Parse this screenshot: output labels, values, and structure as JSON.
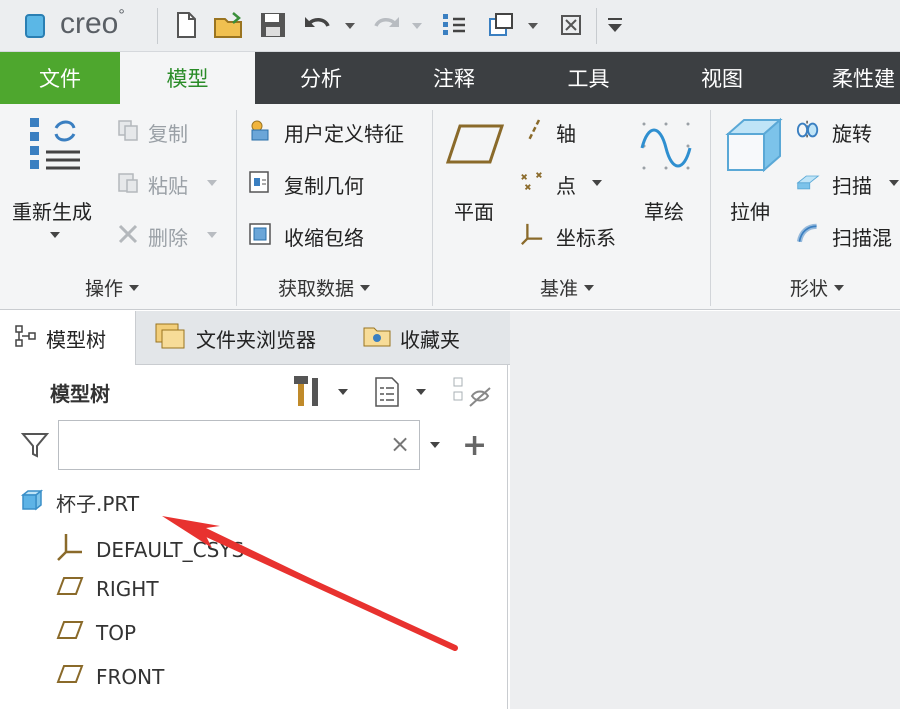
{
  "app": {
    "name": "creo",
    "trademark": "°"
  },
  "tabs": [
    {
      "label": "文件"
    },
    {
      "label": "模型"
    },
    {
      "label": "分析"
    },
    {
      "label": "注释"
    },
    {
      "label": "工具"
    },
    {
      "label": "视图"
    },
    {
      "label": "柔性建"
    }
  ],
  "ribbon": {
    "operations": {
      "regenerate": "重新生成",
      "copy": "复制",
      "paste": "粘贴",
      "delete": "删除",
      "group_label": "操作"
    },
    "get_data": {
      "user_defined_feature": "用户定义特征",
      "copy_geometry": "复制几何",
      "shrinkwrap": "收缩包络",
      "group_label": "获取数据"
    },
    "datum": {
      "plane": "平面",
      "axis": "轴",
      "point": "点",
      "csys": "坐标系",
      "sketch": "草绘",
      "group_label": "基准"
    },
    "shapes": {
      "extrude": "拉伸",
      "revolve": "旋转",
      "sweep": "扫描",
      "swept_blend": "扫描混",
      "group_label": "形状"
    }
  },
  "panel": {
    "tabs": [
      {
        "label": "模型树"
      },
      {
        "label": "文件夹浏览器"
      },
      {
        "label": "收藏夹"
      }
    ],
    "header_title": "模型树",
    "search": {
      "value": "",
      "placeholder": ""
    },
    "clear_symbol": "×",
    "add_symbol": "+"
  },
  "tree": {
    "root": "杯子.PRT",
    "items": [
      {
        "label": "DEFAULT_CSYS",
        "icon": "csys-icon"
      },
      {
        "label": "RIGHT",
        "icon": "datum-plane-icon"
      },
      {
        "label": "TOP",
        "icon": "datum-plane-icon"
      },
      {
        "label": "FRONT",
        "icon": "datum-plane-icon"
      }
    ]
  },
  "colors": {
    "file_tab": "#4ea72e",
    "active_tab_text": "#2a8c28",
    "tab_bar": "#3c3f42",
    "annotation_arrow": "#e8322f"
  }
}
